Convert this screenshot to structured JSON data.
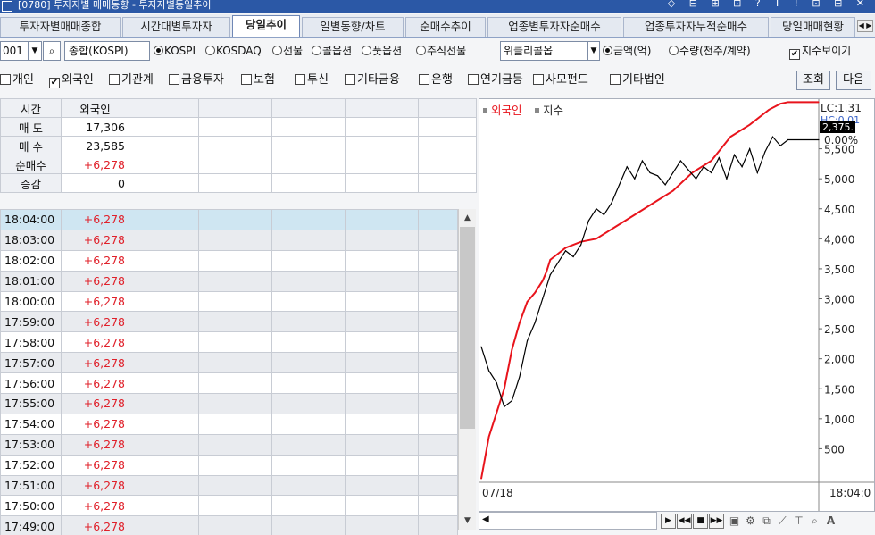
{
  "titlebar": {
    "text": "[0780] 투자자별 매매동향 - 투자자별동일추이",
    "controls": "◇ ⊟ ⊞ ⊡ ? T ! ⊡ ⊟ ✕"
  },
  "tabs": [
    "투자자별매매종합",
    "시간대별투자자",
    "당일추이",
    "일별동향/차트",
    "순매수추이",
    "업종별투자자순매수",
    "업종투자자누적순매수",
    "당일매매현황"
  ],
  "active_tab": "당일추이",
  "controls": {
    "code": "001",
    "market_name": "종합(KOSPI)",
    "radio_market": [
      {
        "label": "KOSPI",
        "selected": true
      },
      {
        "label": "KOSDAQ",
        "selected": false
      },
      {
        "label": "선물",
        "selected": false
      },
      {
        "label": "콜옵션",
        "selected": false
      },
      {
        "label": "풋옵션",
        "selected": false
      },
      {
        "label": "주식선물",
        "selected": false
      }
    ],
    "weekly_select": "위클리콜옵",
    "radio_unit": [
      {
        "label": "금액(억)",
        "selected": true
      },
      {
        "label": "수량(천주/계약)",
        "selected": false
      }
    ],
    "show_index_label": "지수보이기",
    "show_index_checked": true
  },
  "investors": [
    {
      "label": "개인",
      "checked": false
    },
    {
      "label": "외국인",
      "checked": true
    },
    {
      "label": "기관계",
      "checked": false
    },
    {
      "label": "금융투자",
      "checked": false
    },
    {
      "label": "보험",
      "checked": false
    },
    {
      "label": "투신",
      "checked": false
    },
    {
      "label": "기타금융",
      "checked": false
    },
    {
      "label": "은행",
      "checked": false
    },
    {
      "label": "연기금등",
      "checked": false
    },
    {
      "label": "사모펀드",
      "checked": false
    },
    {
      "label": "기타법인",
      "checked": false
    }
  ],
  "buttons": {
    "query": "조회",
    "next": "다음"
  },
  "summary": {
    "headers": [
      "시간",
      "외국인"
    ],
    "rows": [
      {
        "label": "매 도",
        "value": "17,306",
        "red": false
      },
      {
        "label": "매 수",
        "value": "23,585",
        "red": false
      },
      {
        "label": "순매수",
        "value": "+6,278",
        "red": true
      },
      {
        "label": "증감",
        "value": "0",
        "red": false
      }
    ]
  },
  "time_rows": [
    {
      "time": "18:04:00",
      "value": "+6,278"
    },
    {
      "time": "18:03:00",
      "value": "+6,278"
    },
    {
      "time": "18:02:00",
      "value": "+6,278"
    },
    {
      "time": "18:01:00",
      "value": "+6,278"
    },
    {
      "time": "18:00:00",
      "value": "+6,278"
    },
    {
      "time": "17:59:00",
      "value": "+6,278"
    },
    {
      "time": "17:58:00",
      "value": "+6,278"
    },
    {
      "time": "17:57:00",
      "value": "+6,278"
    },
    {
      "time": "17:56:00",
      "value": "+6,278"
    },
    {
      "time": "17:55:00",
      "value": "+6,278"
    },
    {
      "time": "17:54:00",
      "value": "+6,278"
    },
    {
      "time": "17:53:00",
      "value": "+6,278"
    },
    {
      "time": "17:52:00",
      "value": "+6,278"
    },
    {
      "time": "17:51:00",
      "value": "+6,278"
    },
    {
      "time": "17:50:00",
      "value": "+6,278"
    },
    {
      "time": "17:49:00",
      "value": "+6,278"
    }
  ],
  "colors": {
    "foreign": "#e8141c",
    "index": "#000000",
    "accent": "#2b58a6",
    "selected_row": "#cfe6f2"
  },
  "chart_data": {
    "type": "line",
    "legend": [
      "외국인",
      "지수"
    ],
    "legend_position": "top-left",
    "x_start_label": "07/18",
    "x_end_label": "18:04:0",
    "right_axis_ticks": [
      "5,500",
      "5,000",
      "4,500",
      "4,000",
      "3,500",
      "3,000",
      "2,500",
      "2,000",
      "1,500",
      "1,000",
      "500"
    ],
    "ylim": [
      0,
      6000
    ],
    "lc_label": "LC:1.31",
    "hc_label": "HC:0.01",
    "pct_label": "0.00%",
    "current_badge": "2,375.",
    "grid": true,
    "series": [
      {
        "name": "외국인",
        "color": "#e8141c",
        "x": [
          0,
          2,
          4,
          6,
          8,
          10,
          12,
          14,
          16,
          17,
          18,
          20,
          22,
          24,
          26,
          30,
          35,
          40,
          45,
          50,
          55,
          60,
          65,
          70,
          75,
          78,
          80,
          82,
          83,
          84,
          88
        ],
        "values": [
          0,
          700,
          1100,
          1500,
          2150,
          2600,
          2950,
          3100,
          3300,
          3450,
          3650,
          3750,
          3850,
          3900,
          3950,
          4000,
          4200,
          4400,
          4600,
          4800,
          5100,
          5300,
          5700,
          5900,
          6150,
          6250,
          6278,
          6278,
          6278,
          6278,
          6278
        ]
      },
      {
        "name": "지수",
        "color": "#000000",
        "x": [
          0,
          2,
          4,
          6,
          8,
          10,
          12,
          14,
          16,
          18,
          20,
          22,
          24,
          26,
          28,
          30,
          32,
          34,
          36,
          38,
          40,
          42,
          44,
          46,
          48,
          50,
          52,
          54,
          56,
          58,
          60,
          62,
          64,
          66,
          68,
          70,
          72,
          74,
          76,
          78,
          80,
          88
        ],
        "values": [
          2200,
          1800,
          1600,
          1200,
          1300,
          1700,
          2300,
          2600,
          3000,
          3400,
          3600,
          3800,
          3700,
          3900,
          4300,
          4500,
          4400,
          4600,
          4900,
          5200,
          5000,
          5300,
          5100,
          5050,
          4900,
          5100,
          5300,
          5150,
          5000,
          5200,
          5100,
          5350,
          5000,
          5400,
          5200,
          5500,
          5100,
          5450,
          5700,
          5550,
          5650,
          5650
        ]
      }
    ]
  }
}
